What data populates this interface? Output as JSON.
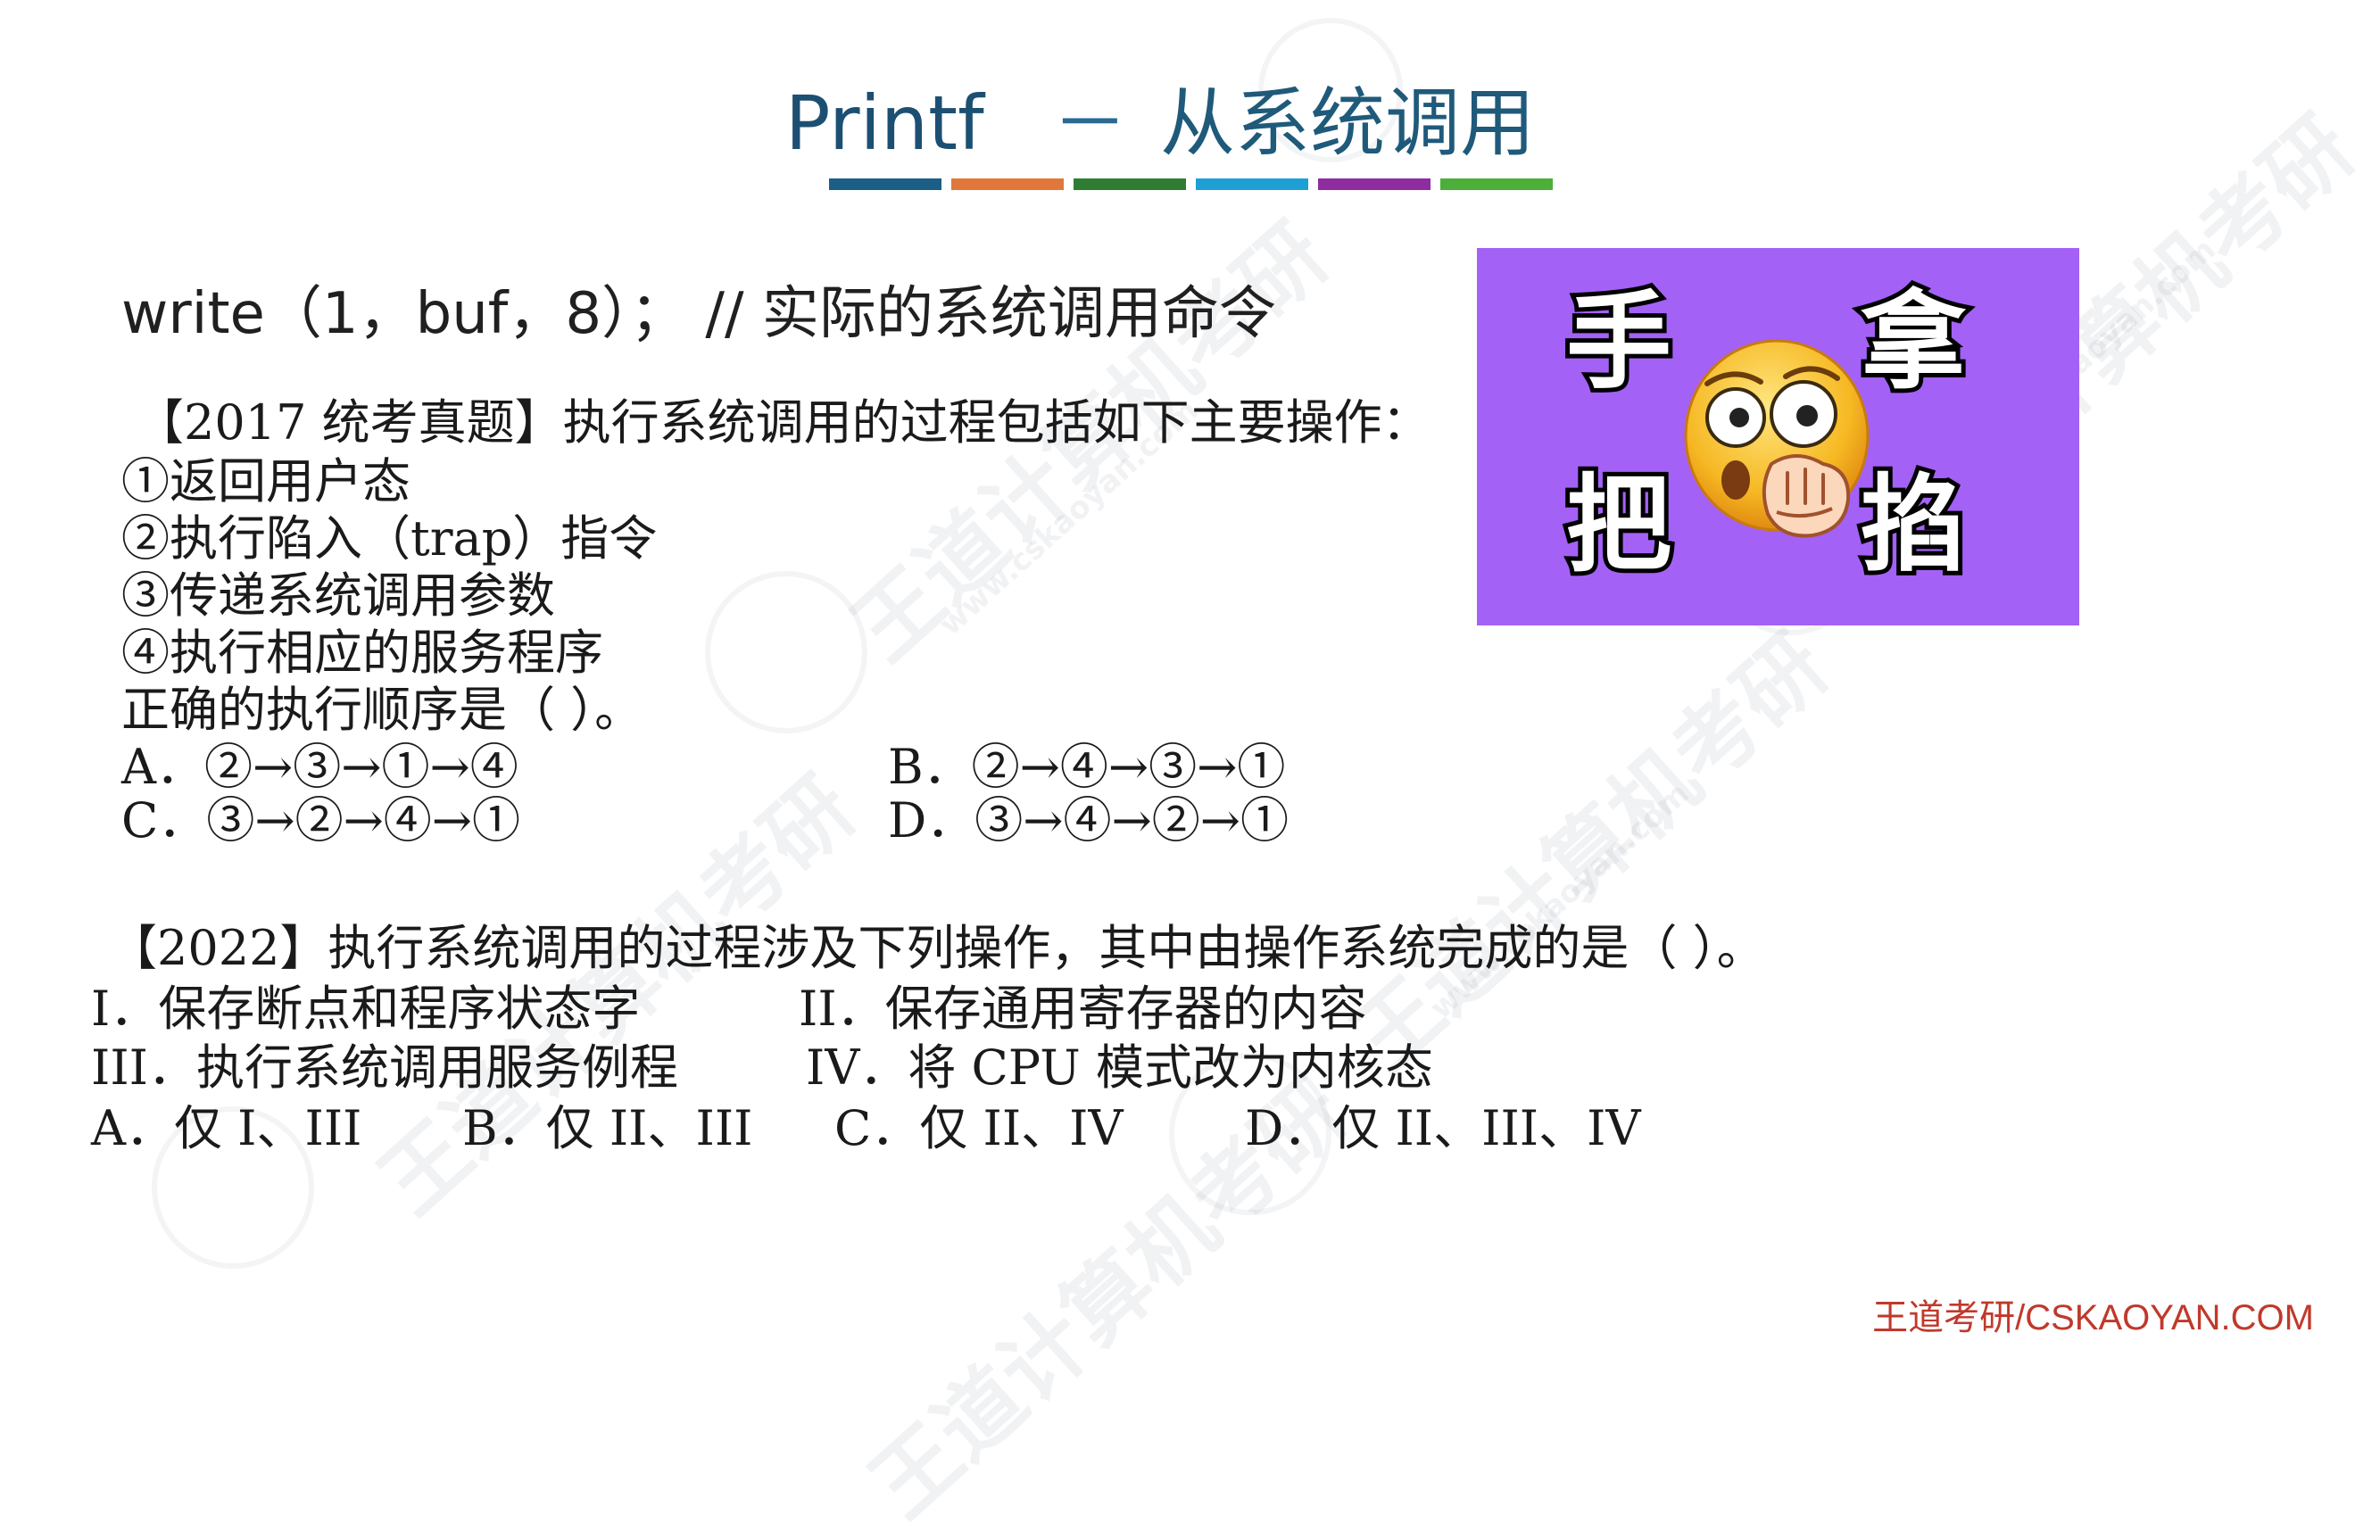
{
  "title": {
    "main": "Printf",
    "separator": "－",
    "sub": "从系统调用"
  },
  "stripe_colors": [
    "#1b5e86",
    "#e1773a",
    "#2e7d32",
    "#1e9fd6",
    "#8e2ca0",
    "#4caf3a"
  ],
  "command_line": "write（1，buf，8）；   //  实际的系统调用命令",
  "meme": {
    "background": "#a461f6",
    "characters": [
      "手",
      "拿",
      "把",
      "掐"
    ],
    "emoji": "shocked-face-fist-emoji"
  },
  "q2017": {
    "header": "【2017 统考真题】执行系统调用的过程包括如下主要操作：",
    "steps": [
      "①返回用户态",
      "②执行陷入（trap）指令",
      "③传递系统调用参数",
      "④执行相应的服务程序"
    ],
    "prompt": "正确的执行顺序是（ ）。",
    "options": {
      "A": "A．②→③→①→④",
      "B": "B．②→④→③→①",
      "C": "C．③→②→④→①",
      "D": "D．③→④→②→①"
    }
  },
  "q2022": {
    "header": "【2022】执行系统调用的过程涉及下列操作，其中由操作系统完成的是（ ）。",
    "items": [
      "I．保存断点和程序状态字",
      "II．保存通用寄存器的内容",
      "III．执行系统调用服务例程",
      "IV．将 CPU 模式改为内核态"
    ],
    "options": [
      "A．仅 I、III",
      "B．仅 II、III",
      "C．仅 II、IV",
      "D．仅 II、III、IV"
    ]
  },
  "watermark": {
    "text": "王道计算机考研",
    "url": "www.cskaoyan.com"
  },
  "footer": "王道考研/CSKAOYAN.COM"
}
